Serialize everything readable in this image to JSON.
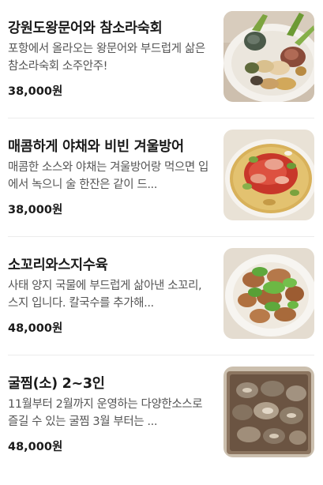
{
  "menu": {
    "items": [
      {
        "name": "강원도왕문어와 참소라숙회",
        "description": "포항에서 올라오는 왕문어와 부드럽게 삶은 참소라숙회 소주안주!",
        "price": "38,000원",
        "image_icon": "octopus-conch-platter"
      },
      {
        "name": "매콤하게 야채와 비빈 겨울방어",
        "description": "매콤한 소스와 야채는 겨울방어랑 먹으면 입에서 녹으니 술 한잔은 같이 드...",
        "price": "38,000원",
        "image_icon": "spicy-yellowtail-salad"
      },
      {
        "name": "소꼬리와스지수육",
        "description": "사태 양지 국물에 부드럽게 삶아낸 소꼬리, 스지 입니다. 칼국수를 추가해...",
        "price": "48,000원",
        "image_icon": "oxtail-suyuk-plate"
      },
      {
        "name": "굴찜(소) 2~3인",
        "description": "11월부터 2월까지 운영하는 다양한소스로 즐길 수 있는 굴찜 3월 부터는 ...",
        "price": "48,000원",
        "image_icon": "steamed-oyster-box"
      }
    ]
  }
}
